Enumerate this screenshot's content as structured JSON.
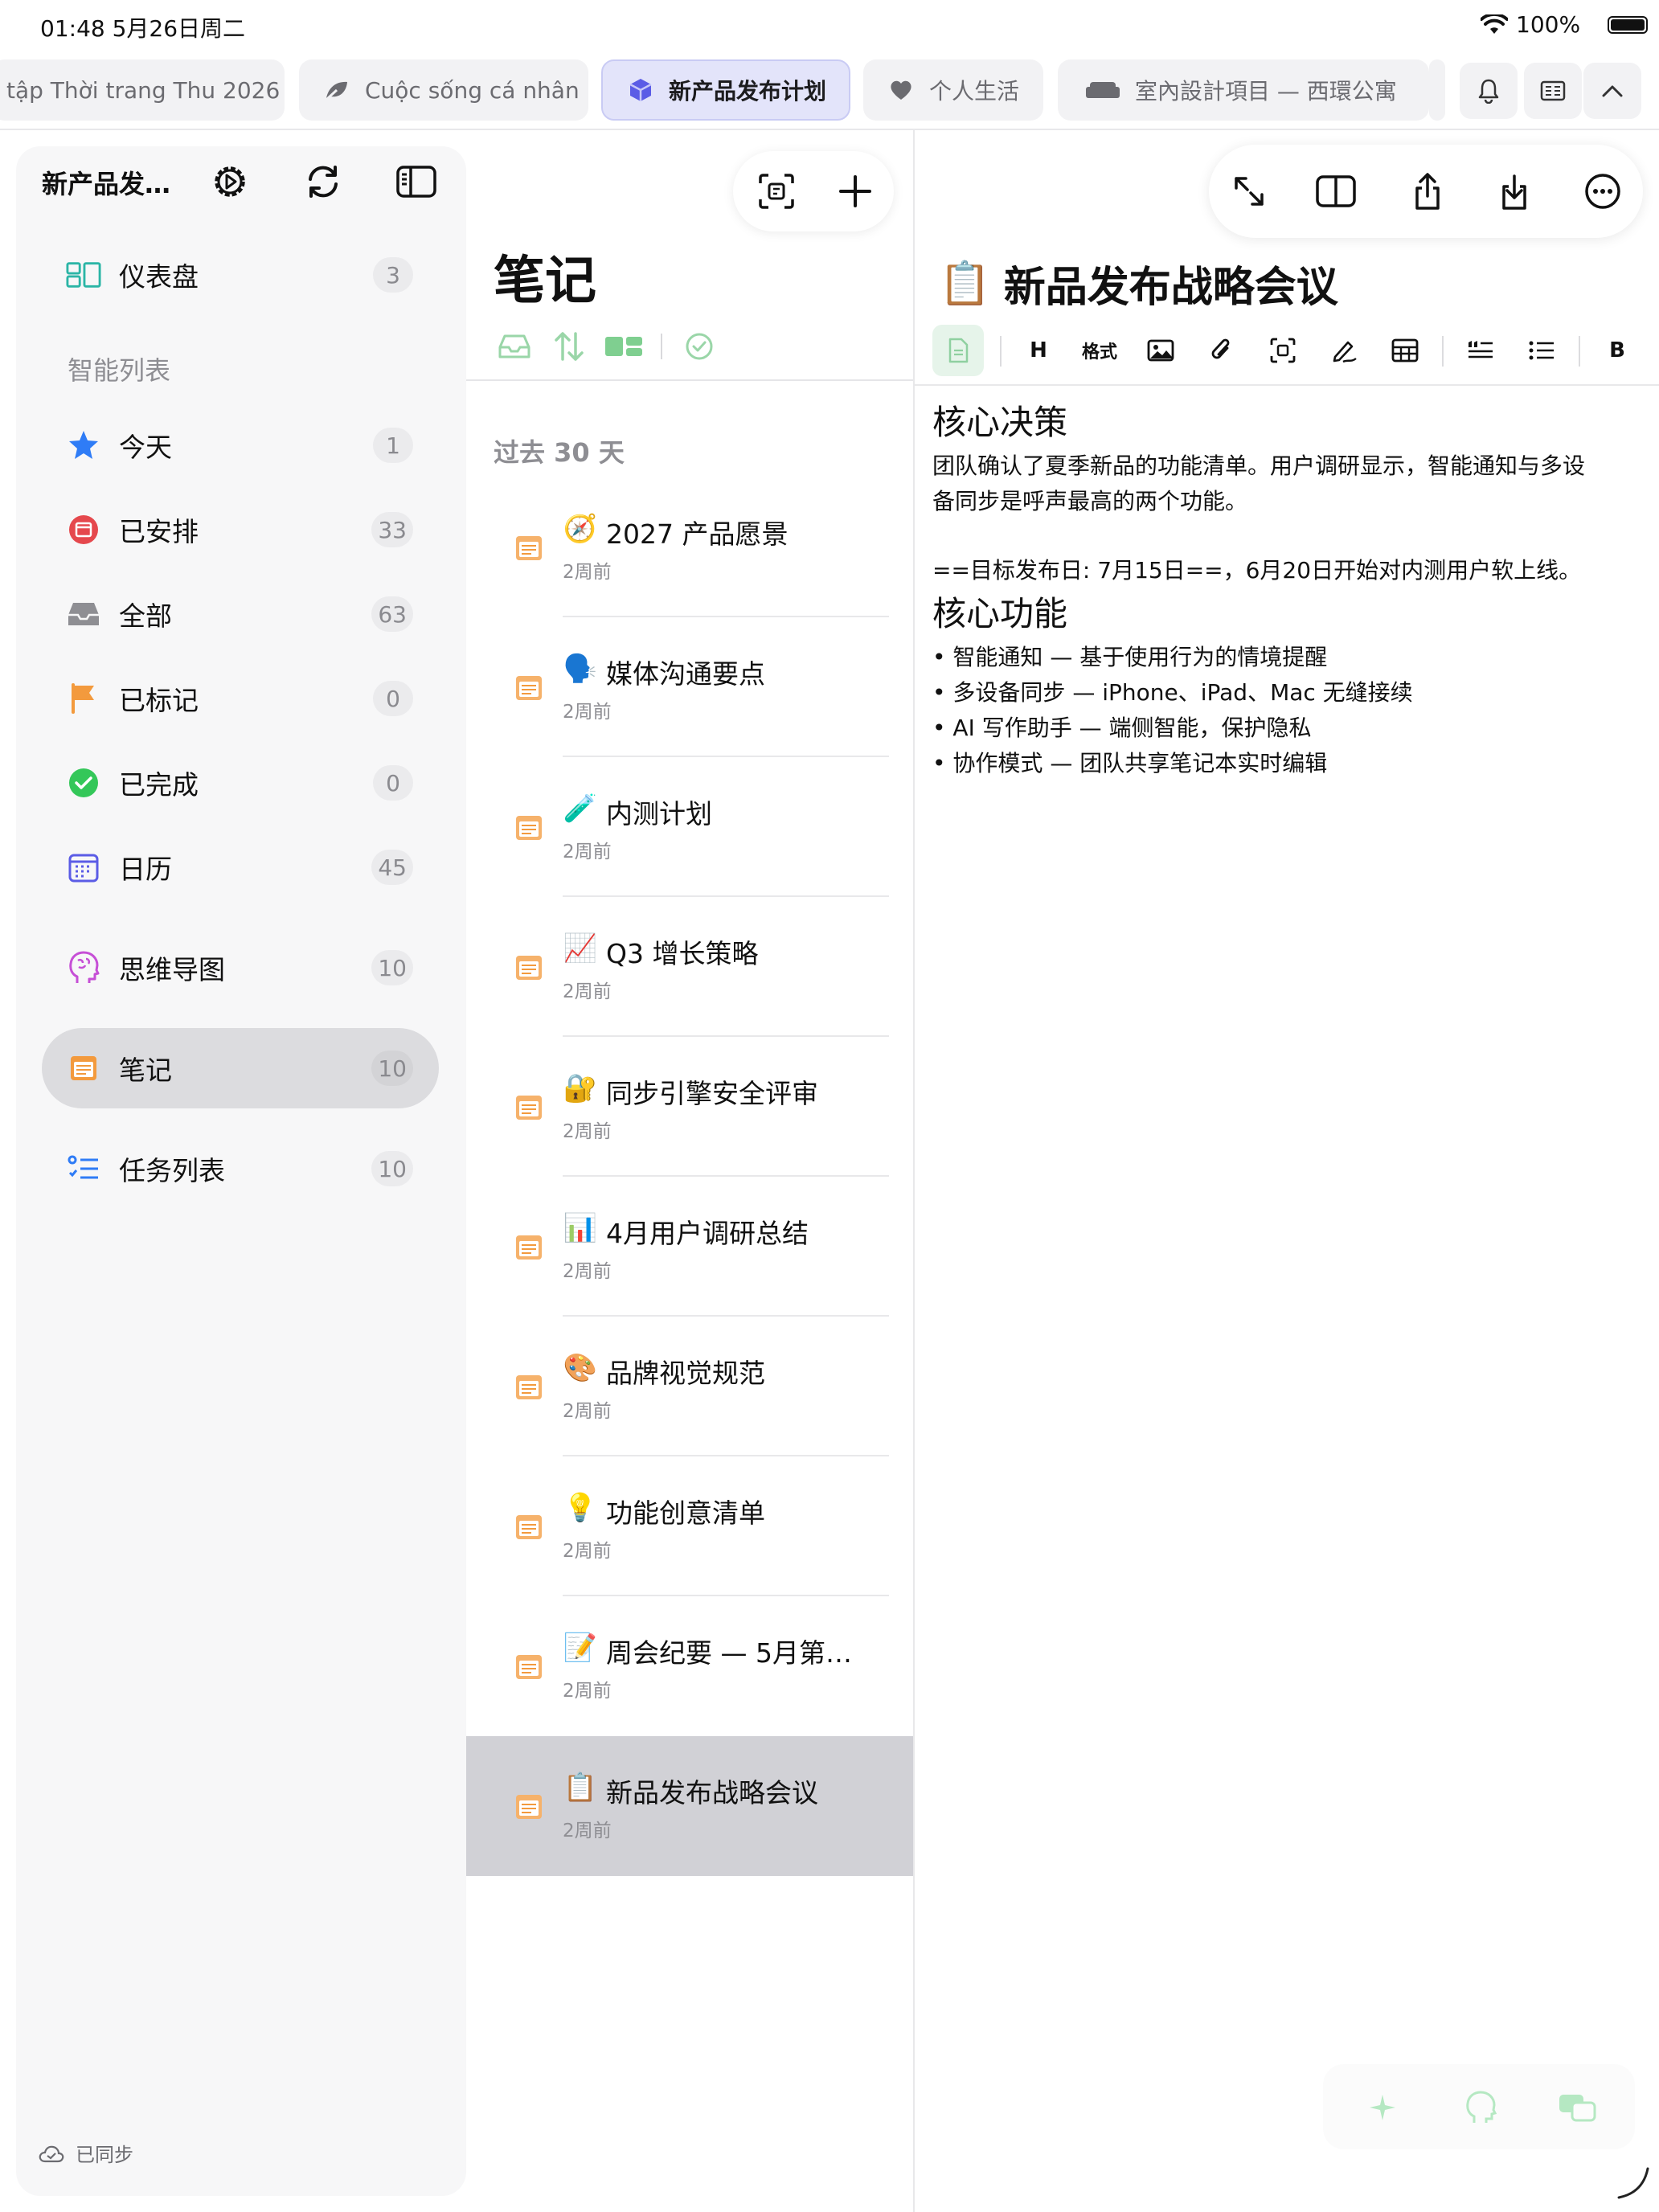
{
  "status_bar": {
    "time": "01:48  5月26日周二",
    "battery": "100%"
  },
  "tabs": [
    {
      "label": "tập Thời trang Thu 2026",
      "icon": "none",
      "active": false
    },
    {
      "label": "Cuộc sống cá nhân",
      "icon": "leaf-icon",
      "active": false
    },
    {
      "label": "新产品发布计划",
      "icon": "cube-icon",
      "active": true
    },
    {
      "label": "个人生活",
      "icon": "heart-icon",
      "active": false
    },
    {
      "label": "室內設計項目 — 西環公寓",
      "icon": "sofa-icon",
      "active": false
    }
  ],
  "sidebar": {
    "title": "新产品发…",
    "section_label": "智能列表",
    "items": [
      {
        "label": "仪表盘",
        "count": "3",
        "icon": "dashboard-icon"
      },
      {
        "label": "今天",
        "count": "1",
        "icon": "star-icon"
      },
      {
        "label": "已安排",
        "count": "33",
        "icon": "scheduled-icon"
      },
      {
        "label": "全部",
        "count": "63",
        "icon": "inbox-icon"
      },
      {
        "label": "已标记",
        "count": "0",
        "icon": "flag-icon"
      },
      {
        "label": "已完成",
        "count": "0",
        "icon": "check-circle-icon"
      },
      {
        "label": "日历",
        "count": "45",
        "icon": "calendar-icon"
      },
      {
        "label": "思维导图",
        "count": "10",
        "icon": "brain-icon"
      },
      {
        "label": "笔记",
        "count": "10",
        "icon": "note-icon"
      },
      {
        "label": "任务列表",
        "count": "10",
        "icon": "task-list-icon"
      }
    ],
    "footer": "已同步"
  },
  "notes_list": {
    "title": "笔记",
    "group_label": "过去 30 天",
    "notes": [
      {
        "emoji": "🧭",
        "title": "2027 产品愿景",
        "date": "2周前"
      },
      {
        "emoji": "🗣️",
        "title": "媒体沟通要点",
        "date": "2周前"
      },
      {
        "emoji": "🧪",
        "title": "内测计划",
        "date": "2周前"
      },
      {
        "emoji": "📈",
        "title": "Q3 增长策略",
        "date": "2周前"
      },
      {
        "emoji": "🔐",
        "title": "同步引擎安全评审",
        "date": "2周前"
      },
      {
        "emoji": "📊",
        "title": "4月用户调研总结",
        "date": "2周前"
      },
      {
        "emoji": "🎨",
        "title": "品牌视觉规范",
        "date": "2周前"
      },
      {
        "emoji": "💡",
        "title": "功能创意清单",
        "date": "2周前"
      },
      {
        "emoji": "📝",
        "title": "周会纪要 — 5月第…",
        "date": "2周前"
      },
      {
        "emoji": "📋",
        "title": "新品发布战略会议",
        "date": "2周前"
      }
    ]
  },
  "editor": {
    "title_emoji": "📋",
    "title": "新品发布战略会议",
    "format_bar": {
      "heading_label": "H",
      "format_label": "格式",
      "bold_label": "B"
    },
    "section1_heading": "核心决策",
    "section1_para_line1": "团队确认了夏季新品的功能清单。用户调研显示，智能通知与多设",
    "section1_para_line2": "备同步是呼声最高的两个功能。",
    "highlight_line": "==目标发布日: 7月15日==，6月20日开始对内测用户软上线。",
    "section2_heading": "核心功能",
    "bullets": [
      "• 智能通知 — 基于使用行为的情境提醒",
      "• 多设备同步 — iPhone、iPad、Mac 无缝接续",
      "• AI 写作助手 — 端侧智能，保护隐私",
      "• 协作模式 — 团队共享笔记本实时编辑"
    ]
  },
  "colors": {
    "accent": "#5b5ce6",
    "note_orange": "#f39a3d",
    "green": "#34c759",
    "red": "#e5484d",
    "blue": "#2f7cf6"
  }
}
